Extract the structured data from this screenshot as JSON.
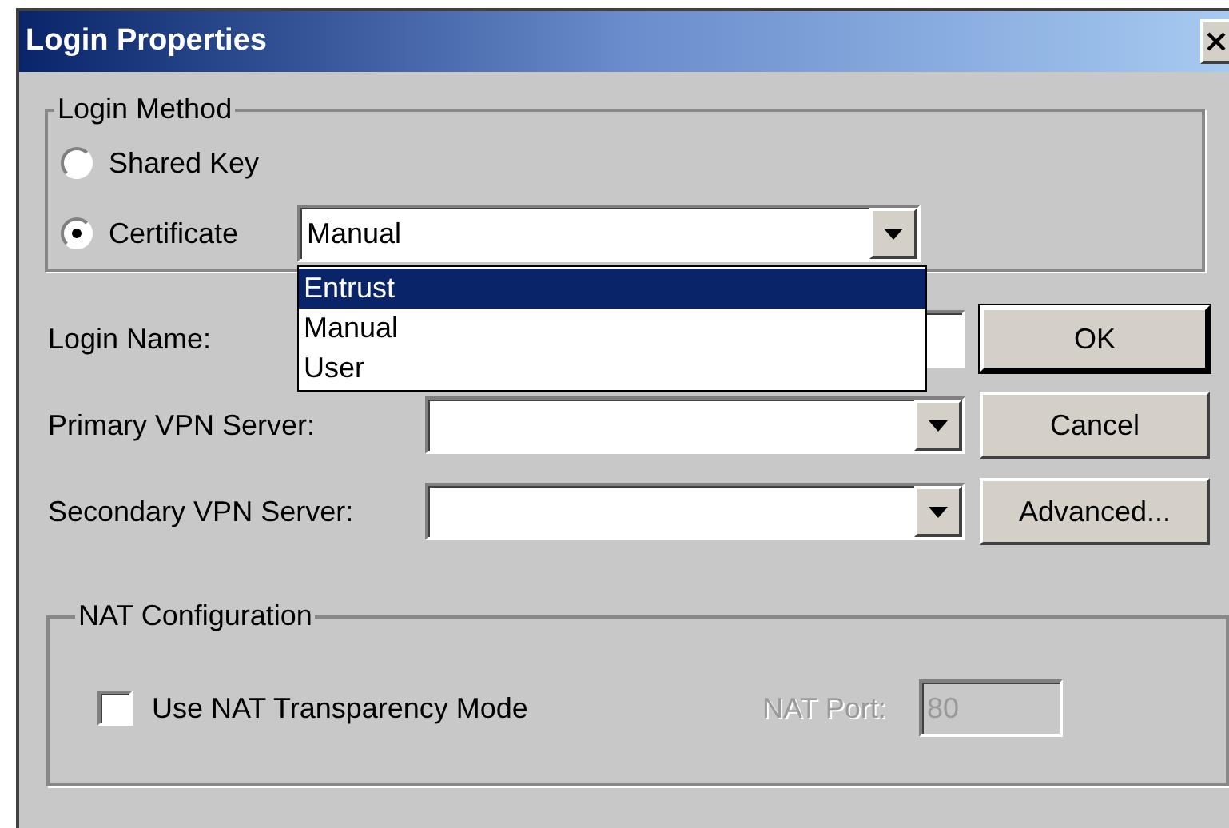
{
  "window": {
    "title": "Login Properties"
  },
  "login_method": {
    "label": "Login Method",
    "options": [
      {
        "label": "Shared Key",
        "selected": false
      },
      {
        "label": "Certificate",
        "selected": true
      }
    ],
    "certificate_combo": {
      "value": "Manual",
      "expanded": true,
      "options": [
        {
          "label": "Entrust",
          "highlighted": true
        },
        {
          "label": "Manual",
          "highlighted": false
        },
        {
          "label": "User",
          "highlighted": false
        }
      ]
    }
  },
  "fields": [
    {
      "label": "Login Name:",
      "kind": "text"
    },
    {
      "label": "Primary VPN Server:",
      "kind": "combo"
    },
    {
      "label": "Secondary VPN Server:",
      "kind": "combo"
    }
  ],
  "buttons": [
    {
      "label": "OK",
      "default": true
    },
    {
      "label": "Cancel",
      "default": false
    },
    {
      "label": "Advanced...",
      "default": false
    }
  ],
  "nat": {
    "label": "NAT Configuration",
    "checkbox": {
      "label": "Use NAT Transparency Mode",
      "checked": false
    },
    "port": {
      "label": "NAT Port:",
      "value": "80",
      "disabled": true
    }
  }
}
